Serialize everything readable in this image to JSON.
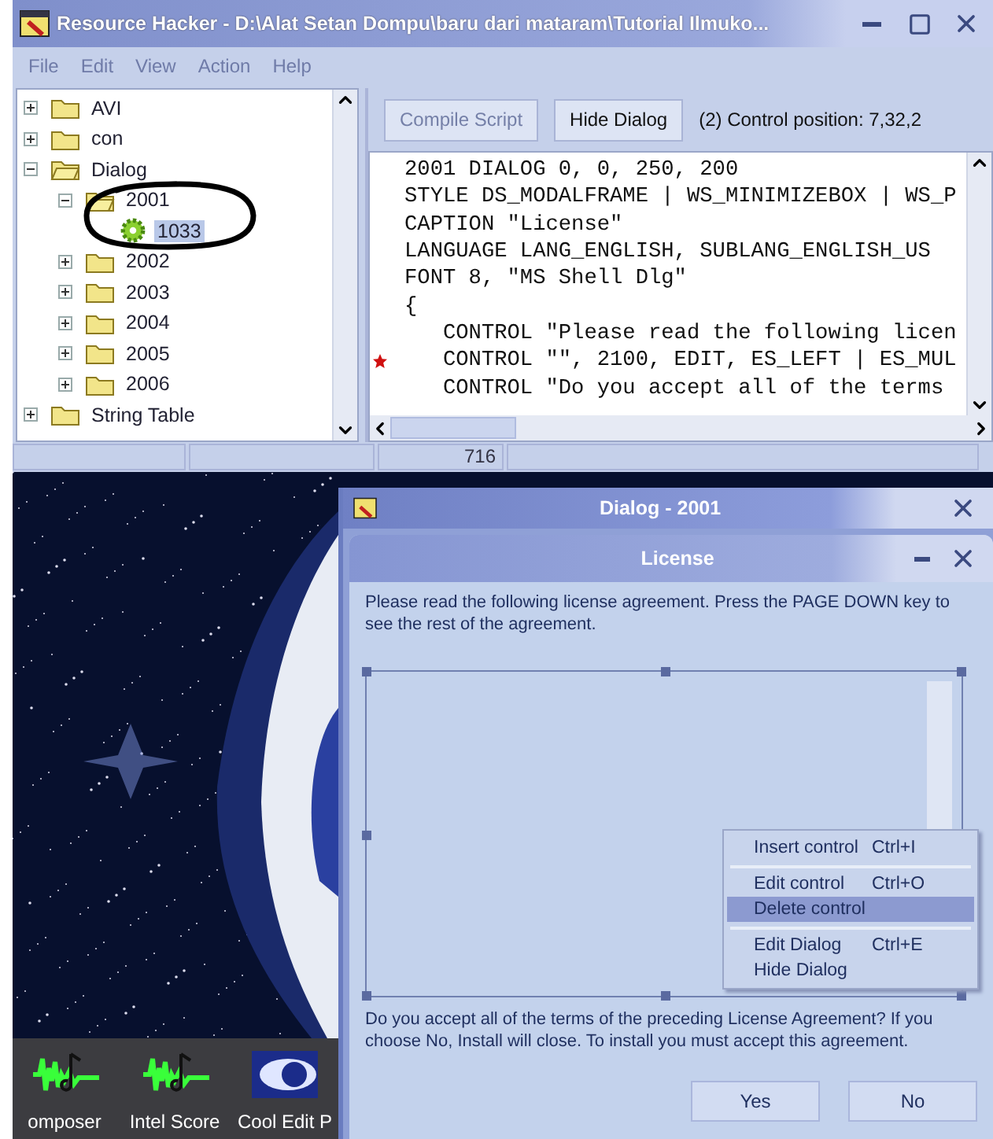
{
  "main_window": {
    "title": "Resource Hacker  -  D:\\Alat Setan Dompu\\baru dari mataram\\Tutorial Ilmuko...",
    "menu": [
      {
        "label": "File",
        "disabled": true
      },
      {
        "label": "Edit",
        "disabled": true
      },
      {
        "label": "View",
        "disabled": true
      },
      {
        "label": "Action",
        "disabled": true
      },
      {
        "label": "Help",
        "disabled": true
      }
    ],
    "tree": [
      {
        "label": "AVI",
        "kind": "folder",
        "expanded": false,
        "selected": false
      },
      {
        "label": "con",
        "kind": "folder",
        "expanded": false,
        "selected": false
      },
      {
        "label": "Dialog",
        "kind": "folder",
        "expanded": true,
        "selected": false,
        "children": [
          {
            "label": "2001",
            "kind": "folder",
            "expanded": true,
            "selected": false,
            "children": [
              {
                "label": "1033",
                "kind": "resource",
                "selected": true
              }
            ]
          },
          {
            "label": "2002",
            "kind": "folder",
            "expanded": false,
            "selected": false
          },
          {
            "label": "2003",
            "kind": "folder",
            "expanded": false,
            "selected": false
          },
          {
            "label": "2004",
            "kind": "folder",
            "expanded": false,
            "selected": false
          },
          {
            "label": "2005",
            "kind": "folder",
            "expanded": false,
            "selected": false
          },
          {
            "label": "2006",
            "kind": "folder",
            "expanded": false,
            "selected": false
          }
        ]
      },
      {
        "label": "String Table",
        "kind": "folder",
        "expanded": false,
        "selected": false
      }
    ],
    "buttons": [
      {
        "label": "Compile Script",
        "disabled": true
      },
      {
        "label": "Hide Dialog",
        "disabled": false
      }
    ],
    "control_position": "(2)  Control position: 7,32,2",
    "code_lines": [
      {
        "text": "2001 DIALOG 0, 0, 250, 200",
        "marked": false
      },
      {
        "text": "STYLE DS_MODALFRAME | WS_MINIMIZEBOX | WS_P",
        "marked": false
      },
      {
        "text": "CAPTION \"License\"",
        "marked": false
      },
      {
        "text": "LANGUAGE LANG_ENGLISH, SUBLANG_ENGLISH_US",
        "marked": false
      },
      {
        "text": "FONT 8, \"MS Shell Dlg\"",
        "marked": false
      },
      {
        "text": "{",
        "marked": false
      },
      {
        "text": "   CONTROL \"Please read the following licen",
        "marked": false
      },
      {
        "text": "   CONTROL \"\", 2100, EDIT, ES_LEFT | ES_MUL",
        "marked": true
      },
      {
        "text": "   CONTROL \"Do you accept all of the terms",
        "marked": false
      }
    ],
    "status_bar": {
      "panel_3": "716"
    }
  },
  "dialog_window": {
    "title": "Dialog - 2001",
    "license_window": {
      "title": "License",
      "intro_text": "Please read the following license agreement. Press the PAGE DOWN key to see the rest of the agreement.",
      "context_menu": [
        {
          "kind": "item",
          "label": "Insert control",
          "shortcut": "Ctrl+I",
          "selected": false
        },
        {
          "kind": "separator"
        },
        {
          "kind": "item",
          "label": "Edit control",
          "shortcut": "Ctrl+O",
          "selected": false
        },
        {
          "kind": "item",
          "label": "Delete control",
          "selected": true
        },
        {
          "kind": "separator"
        },
        {
          "kind": "item",
          "label": "Edit Dialog",
          "shortcut": "Ctrl+E",
          "selected": false
        },
        {
          "kind": "item",
          "label": "Hide Dialog",
          "selected": false
        }
      ],
      "question_text": "Do you accept all of the terms of the preceding License Agreement? If you choose No, Install will close. To install you must accept this agreement.",
      "buttons": [
        {
          "label": "Yes"
        },
        {
          "label": "No"
        }
      ]
    }
  },
  "desktop_icons": [
    {
      "label": "omposer"
    },
    {
      "label": "Intel Score"
    },
    {
      "label": "Cool Edit P"
    }
  ]
}
